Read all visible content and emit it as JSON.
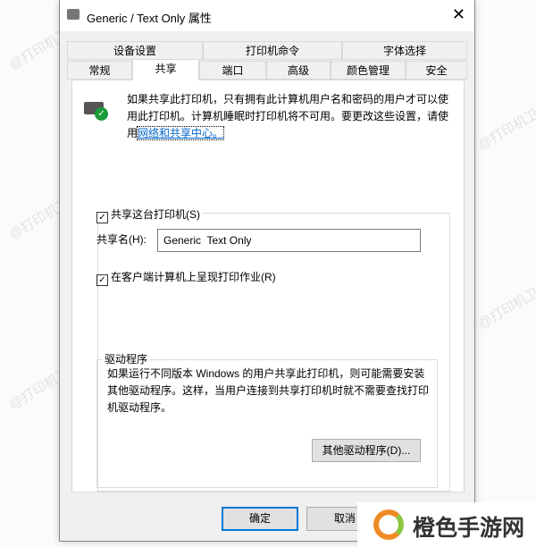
{
  "watermark": "@打印机卫士",
  "window": {
    "title": "Generic / Text Only 属性",
    "close": "✕"
  },
  "tabs_row1": [
    "设备设置",
    "打印机命令",
    "字体选择"
  ],
  "tabs_row2": [
    "常规",
    "共享",
    "端口",
    "高级",
    "颜色管理",
    "安全"
  ],
  "selected_tab": "共享",
  "info": {
    "text": "如果共享此打印机，只有拥有此计算机用户名和密码的用户才可以使用此打印机。计算机睡眠时打印机将不可用。要更改这些设置，请使用",
    "link": "网络和共享中心。"
  },
  "share_checkbox": {
    "label": "共享这台打印机(S)",
    "checked": true
  },
  "share_name": {
    "label": "共享名(H):",
    "value": "Generic  Text Only"
  },
  "render_checkbox": {
    "label": "在客户端计算机上呈现打印作业(R)",
    "checked": true
  },
  "drivers": {
    "legend": "驱动程序",
    "text": "如果运行不同版本 Windows 的用户共享此打印机，则可能需要安装其他驱动程序。这样，当用户连接到共享打印机时就不需要查找打印机驱动程序。",
    "button": "其他驱动程序(D)..."
  },
  "buttons": {
    "ok": "确定",
    "cancel": "取消"
  },
  "brand": "橙色手游网"
}
